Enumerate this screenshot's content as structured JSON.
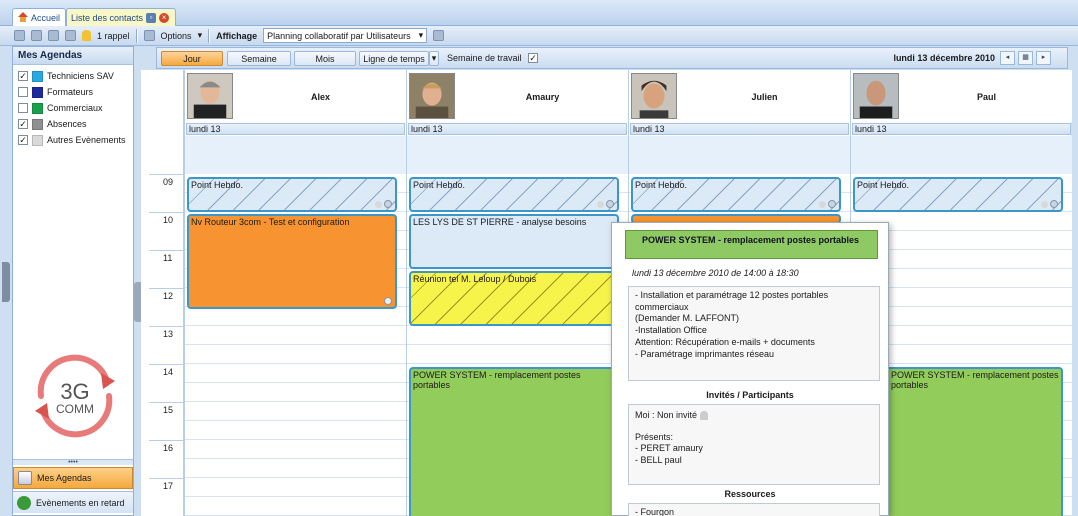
{
  "tabs": {
    "home": "Accueil",
    "contacts": "Liste des contacts"
  },
  "toolbar": {
    "reminder": "1 rappel",
    "options": "Options",
    "display_label": "Affichage",
    "display_value": "Planning collaboratif par Utilisateurs"
  },
  "sidebar": {
    "title": "Mes Agendas",
    "items": [
      {
        "label": "Techniciens SAV",
        "checked": true,
        "color": "#29a9e1"
      },
      {
        "label": "Formateurs",
        "checked": false,
        "color": "#1d2a9e"
      },
      {
        "label": "Commerciaux",
        "checked": false,
        "color": "#18a14a"
      },
      {
        "label": "Absences",
        "checked": true,
        "color": "#8f8f8f"
      },
      {
        "label": "Autres Evènements",
        "checked": true,
        "color": "#d9d9d9"
      }
    ],
    "logo_text_1": "3G",
    "logo_text_2": "COMM",
    "bottom_active": "Mes Agendas",
    "bottom_other": "Evènements en retard"
  },
  "viewbar": {
    "day": "Jour",
    "week": "Semaine",
    "month": "Mois",
    "timeline": "Ligne de temps",
    "workweek": "Semaine de travail",
    "date": "lundi 13 décembre 2010"
  },
  "hours": [
    "09",
    "10",
    "11",
    "12",
    "13",
    "14",
    "15",
    "16",
    "17"
  ],
  "columns": [
    {
      "name": "Alex",
      "day": "lundi 13"
    },
    {
      "name": "Amaury",
      "day": "lundi 13"
    },
    {
      "name": "Julien",
      "day": "lundi 13"
    },
    {
      "name": "Paul",
      "day": "lundi 13"
    }
  ],
  "events": {
    "point_hebdo": "Point Hebdo.",
    "alex_routeur": "Nv Routeur 3com - Test et configuration",
    "amaury_lys": "LES LYS DE ST PIERRE - analyse besoins",
    "amaury_reunion": "Réunion tel M. Leloup / Dubois",
    "amaury_power": "POWER SYSTEM - remplacement postes portables",
    "paul_power": "POWER SYSTEM - remplacement postes portables"
  },
  "popup": {
    "title": "POWER SYSTEM - remplacement postes portables",
    "date": "lundi 13 décembre 2010 de 14:00 à 18:30",
    "description": [
      "- Installation et paramétrage 12 postes portables",
      "commerciaux",
      "(Demander M. LAFFONT)",
      "-Installation Office",
      "Attention: Récupération e-mails + documents",
      "- Paramétrage imprimantes réseau"
    ],
    "participants_title": "Invités / Participants",
    "me": "Moi : Non invité",
    "present_label": "Présents:",
    "present": [
      "- PERET amaury",
      "- BELL paul"
    ],
    "resources_title": "Ressources",
    "resources": [
      "- Fourgon"
    ]
  }
}
